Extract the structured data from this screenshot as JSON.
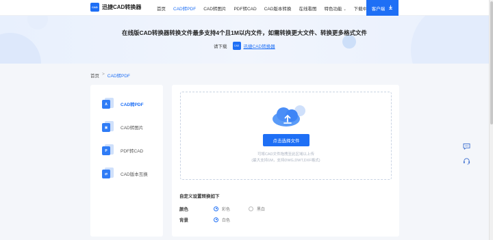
{
  "header": {
    "logo_mark": "CAD",
    "logo_text": "迅捷CAD转换器",
    "nav": [
      {
        "label": "首页",
        "active": false,
        "has_chevron": false
      },
      {
        "label": "CAD转PDF",
        "active": true,
        "has_chevron": false
      },
      {
        "label": "CAD转图片",
        "active": false,
        "has_chevron": false
      },
      {
        "label": "PDF转CAD",
        "active": false,
        "has_chevron": false
      },
      {
        "label": "CAD版本转换",
        "active": false,
        "has_chevron": false
      },
      {
        "label": "在线看图",
        "active": false,
        "has_chevron": false
      },
      {
        "label": "特色功能",
        "active": false,
        "has_chevron": true
      },
      {
        "label": "下载中心",
        "active": false,
        "has_chevron": false
      }
    ],
    "client_button": "客户端",
    "client_icon": "download-icon",
    "accent_color": "#1e6ff5"
  },
  "banner": {
    "title": "在线版CAD转换器转换文件最多支持4个且1M以内文件，如需转换更大文件、转换更多格式文件",
    "sub_prefix": "请下载",
    "app_link": "迅捷CAD转换器",
    "mini_logo": "CAD"
  },
  "breadcrumb": {
    "home": "首页",
    "separator": ">",
    "current": "CAD转PDF"
  },
  "sidebar": {
    "items": [
      {
        "label": "CAD转PDF",
        "active": true,
        "icon": "cad-to-pdf-icon",
        "glyph": "A"
      },
      {
        "label": "CAD转图片",
        "active": false,
        "icon": "cad-to-image-icon",
        "glyph": "▣"
      },
      {
        "label": "PDF转CAD",
        "active": false,
        "icon": "pdf-to-cad-icon",
        "glyph": "P"
      },
      {
        "label": "CAD版本互换",
        "active": false,
        "icon": "cad-version-swap-icon",
        "glyph": "⇄"
      }
    ]
  },
  "upload": {
    "button_label": "点击选择文件",
    "hint_line1": "可将CAD文件拖拽至此区域以上传",
    "hint_line2": "(最大支持1M，支持DWG,DWT,DXF格式)",
    "icon": "cloud-upload-icon"
  },
  "settings": {
    "title": "自定义设置转换如下",
    "color": {
      "label": "颜色",
      "options": [
        {
          "label": "彩色",
          "checked": true
        },
        {
          "label": "黑白",
          "checked": false
        }
      ]
    },
    "background": {
      "label": "背景",
      "options": [
        {
          "label": "白色",
          "checked": true
        }
      ]
    }
  },
  "floating": {
    "chat_icon": "chat-icon",
    "feedback_icon": "headset-icon"
  }
}
